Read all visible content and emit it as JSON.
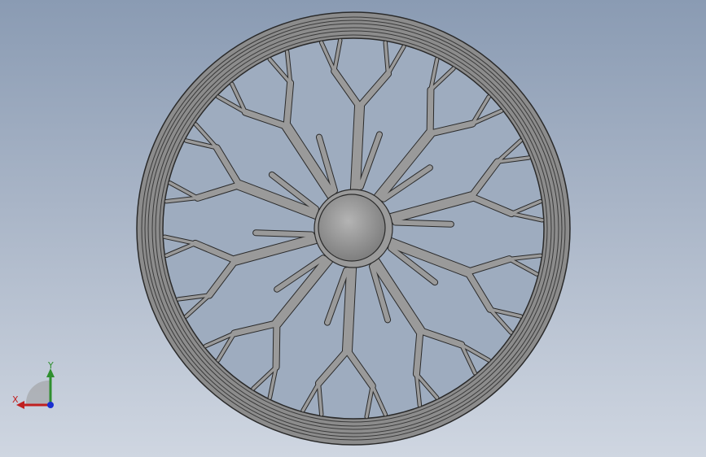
{
  "viewport": {
    "background_top": "#8a9bb3",
    "background_bottom": "#cfd6e1"
  },
  "model": {
    "part": "spoked-wheel",
    "spoke_count": 10,
    "rim_color": "#8c8c8c",
    "spoke_color": "#9a9a9a",
    "hub_color": "#8f8f8f",
    "edge_color": "#2a2a2a"
  },
  "triad": {
    "x_label": "X",
    "y_label": "Y",
    "x_color": "#c02020",
    "y_color": "#2f8f2f",
    "z_color": "#1a2fd0"
  }
}
